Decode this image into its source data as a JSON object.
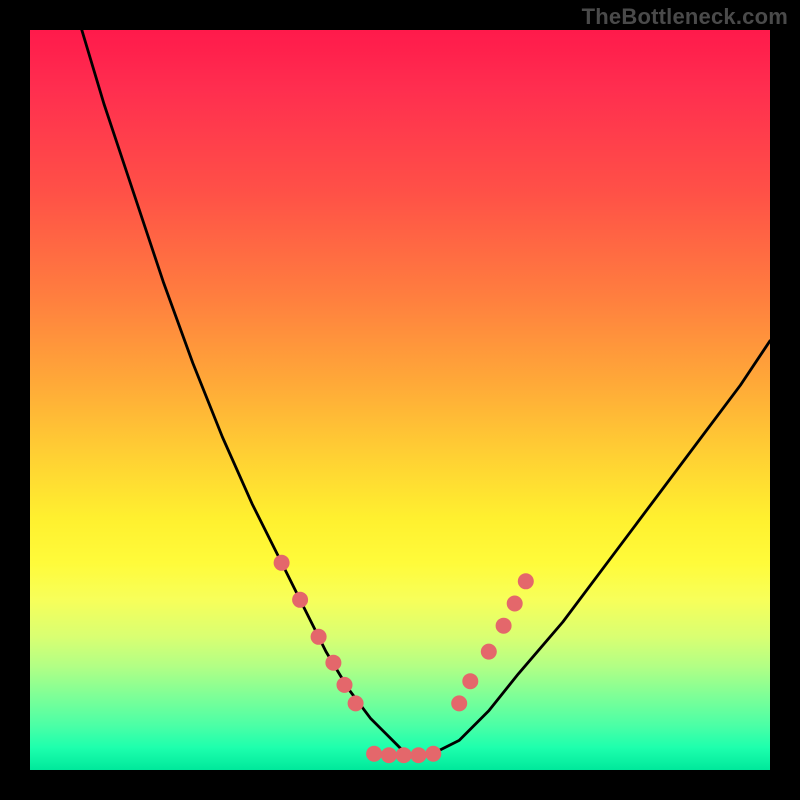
{
  "watermark": "TheBottleneck.com",
  "chart_data": {
    "type": "line",
    "title": "",
    "xlabel": "",
    "ylabel": "",
    "xlim": [
      0,
      100
    ],
    "ylim": [
      0,
      100
    ],
    "grid": false,
    "legend": false,
    "background_gradient_stops": [
      {
        "pct": 0,
        "color": "#ff1a4b"
      },
      {
        "pct": 8,
        "color": "#ff2e4f"
      },
      {
        "pct": 22,
        "color": "#ff5147"
      },
      {
        "pct": 36,
        "color": "#ff7e3f"
      },
      {
        "pct": 48,
        "color": "#ffaa38"
      },
      {
        "pct": 58,
        "color": "#ffd233"
      },
      {
        "pct": 66,
        "color": "#fff02f"
      },
      {
        "pct": 72,
        "color": "#fffb3a"
      },
      {
        "pct": 77,
        "color": "#f7ff5a"
      },
      {
        "pct": 82,
        "color": "#d9ff72"
      },
      {
        "pct": 86,
        "color": "#b2ff85"
      },
      {
        "pct": 90,
        "color": "#7eff97"
      },
      {
        "pct": 94,
        "color": "#4bffa6"
      },
      {
        "pct": 97,
        "color": "#1dffad"
      },
      {
        "pct": 100,
        "color": "#00e89b"
      }
    ],
    "series": [
      {
        "name": "bottleneck-curve",
        "color": "#000000",
        "x": [
          7,
          10,
          14,
          18,
          22,
          26,
          30,
          34,
          37,
          40,
          43,
          46,
          49,
          51,
          54,
          58,
          62,
          66,
          72,
          78,
          84,
          90,
          96,
          100
        ],
        "y": [
          100,
          90,
          78,
          66,
          55,
          45,
          36,
          28,
          22,
          16,
          11,
          7,
          4,
          2,
          2,
          4,
          8,
          13,
          20,
          28,
          36,
          44,
          52,
          58
        ]
      }
    ],
    "markers": {
      "name": "highlight-points",
      "color": "#e4676b",
      "radius_px": 8,
      "points": [
        {
          "x": 34.0,
          "y": 28.0
        },
        {
          "x": 36.5,
          "y": 23.0
        },
        {
          "x": 39.0,
          "y": 18.0
        },
        {
          "x": 41.0,
          "y": 14.5
        },
        {
          "x": 42.5,
          "y": 11.5
        },
        {
          "x": 44.0,
          "y": 9.0
        },
        {
          "x": 46.5,
          "y": 2.2
        },
        {
          "x": 48.5,
          "y": 2.0
        },
        {
          "x": 50.5,
          "y": 2.0
        },
        {
          "x": 52.5,
          "y": 2.0
        },
        {
          "x": 54.5,
          "y": 2.2
        },
        {
          "x": 58.0,
          "y": 9.0
        },
        {
          "x": 59.5,
          "y": 12.0
        },
        {
          "x": 62.0,
          "y": 16.0
        },
        {
          "x": 64.0,
          "y": 19.5
        },
        {
          "x": 65.5,
          "y": 22.5
        },
        {
          "x": 67.0,
          "y": 25.5
        }
      ]
    }
  }
}
